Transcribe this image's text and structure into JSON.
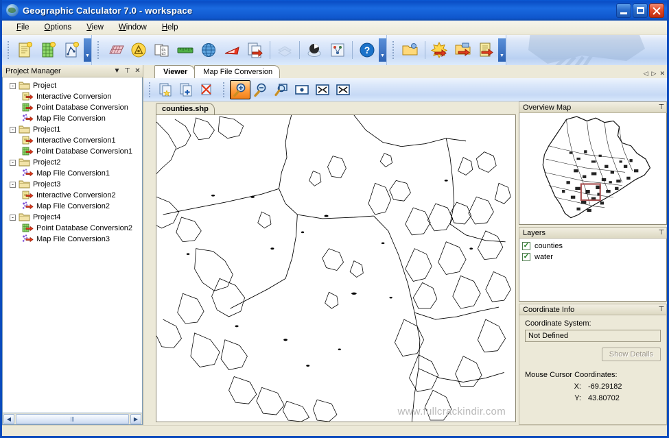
{
  "window": {
    "title": "Geographic Calculator 7.0 - workspace",
    "app_icon": "globe-icon",
    "minimize_label": "Minimize",
    "maximize_label": "Maximize",
    "close_label": "Close"
  },
  "menu": [
    {
      "label": "File",
      "accel": "F"
    },
    {
      "label": "Options",
      "accel": "O"
    },
    {
      "label": "View",
      "accel": "V"
    },
    {
      "label": "Window",
      "accel": "W"
    },
    {
      "label": "Help",
      "accel": "H"
    }
  ],
  "toolbar": {
    "groups": [
      {
        "name": "project-group",
        "buttons": [
          {
            "icon": "new-interactive-conversion-icon",
            "tip": "New Interactive Conversion"
          },
          {
            "icon": "new-point-database-conversion-icon",
            "tip": "New Point Database Conversion"
          },
          {
            "icon": "new-map-file-conversion-icon",
            "tip": "New Map File Conversion"
          }
        ]
      },
      {
        "name": "tools-group",
        "buttons": [
          {
            "icon": "geodetic-grid-icon",
            "tip": "Geodetic Calculator"
          },
          {
            "icon": "datum-transform-icon",
            "tip": "Datum Transformation"
          },
          {
            "icon": "coordinate-pair-icon",
            "tip": "Coordinate Pairs"
          },
          {
            "icon": "ruler-icon",
            "tip": "Measure"
          },
          {
            "icon": "globe-blue-icon",
            "tip": "Geodetic Database"
          },
          {
            "icon": "triangle-icon",
            "tip": "Area Calculator"
          },
          {
            "icon": "export-document-icon",
            "tip": "Export"
          },
          {
            "icon": "layers-disabled-icon",
            "tip": "Layers",
            "disabled": true
          },
          {
            "icon": "seismic-icon",
            "tip": "Seismic Survey"
          },
          {
            "icon": "workflow-icon",
            "tip": "Workflow"
          },
          {
            "icon": "help-icon",
            "tip": "Help"
          }
        ]
      },
      {
        "name": "file-group",
        "buttons": [
          {
            "icon": "open-folder-settings-icon",
            "tip": "Manage Workspaces"
          },
          {
            "icon": "import-burst-icon",
            "tip": "Import"
          },
          {
            "icon": "open-folder-import-icon",
            "tip": "Open Workspace"
          },
          {
            "icon": "document-import-icon",
            "tip": "Import Document"
          }
        ]
      }
    ]
  },
  "project_manager": {
    "title": "Project Manager",
    "dropdown_icon": "chevron-down-icon",
    "pin_icon": "pin-icon",
    "close_icon": "close-icon",
    "tree": [
      {
        "label": "Project",
        "icon": "folder-icon",
        "expander": "-",
        "level": 0
      },
      {
        "label": "Interactive Conversion",
        "icon": "interactive-conversion-icon",
        "level": 1
      },
      {
        "label": "Point Database Conversion",
        "icon": "point-database-conversion-icon",
        "level": 1
      },
      {
        "label": "Map File Conversion",
        "icon": "map-file-conversion-icon",
        "level": 1
      },
      {
        "label": "Project1",
        "icon": "folder-icon",
        "expander": "-",
        "level": 0
      },
      {
        "label": "Interactive Conversion1",
        "icon": "interactive-conversion-icon",
        "level": 1
      },
      {
        "label": "Point Database Conversion1",
        "icon": "point-database-conversion-icon",
        "level": 1
      },
      {
        "label": "Project2",
        "icon": "folder-icon",
        "expander": "-",
        "level": 0
      },
      {
        "label": "Map File Conversion1",
        "icon": "map-file-conversion-icon",
        "level": 1
      },
      {
        "label": "Project3",
        "icon": "folder-icon",
        "expander": "-",
        "level": 0
      },
      {
        "label": "Interactive Conversion2",
        "icon": "interactive-conversion-icon",
        "level": 1
      },
      {
        "label": "Map File Conversion2",
        "icon": "map-file-conversion-icon",
        "level": 1
      },
      {
        "label": "Project4",
        "icon": "folder-icon",
        "expander": "-",
        "level": 0
      },
      {
        "label": "Point Database Conversion2",
        "icon": "point-database-conversion-icon",
        "level": 1
      },
      {
        "label": "Map File Conversion3",
        "icon": "map-file-conversion-icon",
        "level": 1
      }
    ],
    "scroll_left_icon": "chevron-left-icon",
    "scroll_right_icon": "chevron-right-icon"
  },
  "tabs": [
    {
      "label": "Viewer",
      "active": true
    },
    {
      "label": "Map File Conversion",
      "active": false
    }
  ],
  "tab_nav": {
    "prev_icon": "nav-prev-icon",
    "next_icon": "nav-next-icon",
    "close_icon": "close-icon"
  },
  "map_toolbar": [
    {
      "icon": "new-view-icon",
      "tip": "New View",
      "active": false
    },
    {
      "icon": "add-layer-icon",
      "tip": "Add Layer",
      "active": false
    },
    {
      "icon": "delete-layer-icon",
      "tip": "Remove Layer",
      "active": false
    },
    {
      "icon": "zoom-in-icon",
      "tip": "Zoom In",
      "active": true
    },
    {
      "icon": "zoom-out-icon",
      "tip": "Zoom Out",
      "active": false
    },
    {
      "icon": "zoom-window-icon",
      "tip": "Zoom Window",
      "active": false
    },
    {
      "icon": "center-point-icon",
      "tip": "Center",
      "active": false
    },
    {
      "icon": "zoom-selected-icon",
      "tip": "Zoom to Selection",
      "active": false
    },
    {
      "icon": "zoom-extents-icon",
      "tip": "Zoom to Extents",
      "active": false
    }
  ],
  "document": {
    "tab_label": "counties.shp",
    "watermark": "www.fullcrackindir.com"
  },
  "overview_map": {
    "title": "Overview Map",
    "pin_icon": "pin-icon",
    "viewport_color": "#a85050"
  },
  "layers": {
    "title": "Layers",
    "pin_icon": "pin-icon",
    "items": [
      {
        "label": "counties",
        "checked": true
      },
      {
        "label": "water",
        "checked": true
      }
    ]
  },
  "coordinate_info": {
    "title": "Coordinate Info",
    "pin_icon": "pin-icon",
    "coordinate_system_label": "Coordinate System:",
    "coordinate_system_value": "Not Defined",
    "show_details_label": "Show Details",
    "mouse_label": "Mouse Cursor Coordinates:",
    "x_label": "X:",
    "x_value": "-69.29182",
    "y_label": "Y:",
    "y_value": "43.80702"
  },
  "colors": {
    "titlebar": "#0a4ec6",
    "panel": "#ece9d8",
    "accent_active": "#ff9c3c"
  }
}
